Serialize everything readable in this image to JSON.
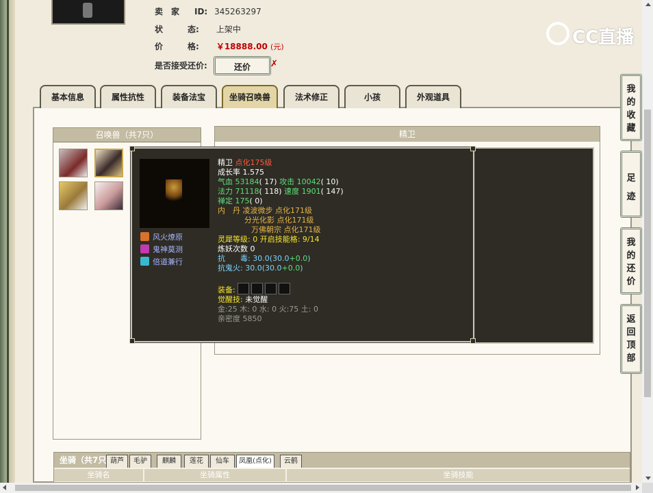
{
  "seller": {
    "label": "卖　家",
    "id_label": "ID:",
    "id": "345263297"
  },
  "status": {
    "label": "状　　　态:",
    "value": "上架中"
  },
  "price": {
    "label": "价　　　格:",
    "value": "￥18888.00",
    "unit": "(元)"
  },
  "counter_offer": {
    "label": "是否接受还价:",
    "button": "还价",
    "mark": "✗"
  },
  "brand": {
    "name": "CC直播"
  },
  "tabs": [
    {
      "label": "基本信息"
    },
    {
      "label": "属性抗性"
    },
    {
      "label": "装备法宝"
    },
    {
      "label": "坐骑召唤兽",
      "active": true
    },
    {
      "label": "法术修正"
    },
    {
      "label": "小孩"
    },
    {
      "label": "外观道具"
    }
  ],
  "pet_panel": {
    "title": "召唤兽（共7只）"
  },
  "detail_panel": {
    "title": "精卫"
  },
  "tooltip": {
    "name": "精卫",
    "level": "点化175级",
    "growth": "成长率 1.575",
    "hp_label": "气血",
    "hp": "53184",
    "hp_pts": "( 17)",
    "atk_label": "攻击",
    "atk": "10042",
    "atk_pts": "( 10)",
    "mp_label": "法力",
    "mp": "71118",
    "mp_pts": "( 118)",
    "spd_label": "速度",
    "spd": "1901",
    "spd_pts": "( 147)",
    "ding_label": "禅定",
    "ding": "175",
    "ding_pts": "( 0)",
    "neidan_label": "内　丹",
    "neidan": [
      "凌波微步 点化171级",
      "分光化影 点化171级",
      "万佛朝宗 点化171级"
    ],
    "lingxi_label": "灵犀等级:",
    "lingxi": "0 开启技能格: 9/14",
    "lianyao": "炼妖次数 0",
    "resist1_label": "抗　　毒:",
    "resist1": "30.0(30.0",
    "resist1_bonus": "+0.0",
    "resist1_end": ")",
    "resist2_label": "抗鬼火:",
    "resist2": "30.0(30.0",
    "resist2_bonus": "+0.0",
    "resist2_end": ")",
    "equip_label": "装备:",
    "awaken_label": "觉醒技:",
    "awaken": "未觉醒",
    "elements": "金:25 木: 0 水: 0 火:75 土: 0",
    "intimacy": "亲密度 5850",
    "skills": [
      {
        "label": "风火燎原",
        "icon": "fire-skill-icon"
      },
      {
        "label": "鬼神莫测",
        "icon": "ghost-skill-icon"
      },
      {
        "label": "倍道兼行",
        "icon": "wind-skill-icon"
      }
    ]
  },
  "mount_panel": {
    "label": "坐骑（共7只",
    "tabs": [
      "葫芦",
      "毛驴",
      "麒麟",
      "莲花",
      "仙车",
      "凤凰(点化)",
      "云鹤"
    ],
    "columns": [
      "坐骑名",
      "坐骑属性",
      "坐骑技能"
    ]
  },
  "side_buttons": [
    {
      "label": [
        "我",
        "的",
        "收",
        "藏"
      ]
    },
    {
      "label": [
        "足",
        "迹"
      ]
    },
    {
      "label": [
        "我",
        "的",
        "还",
        "价"
      ]
    },
    {
      "label": [
        "返",
        "回",
        "顶",
        "部"
      ]
    }
  ]
}
